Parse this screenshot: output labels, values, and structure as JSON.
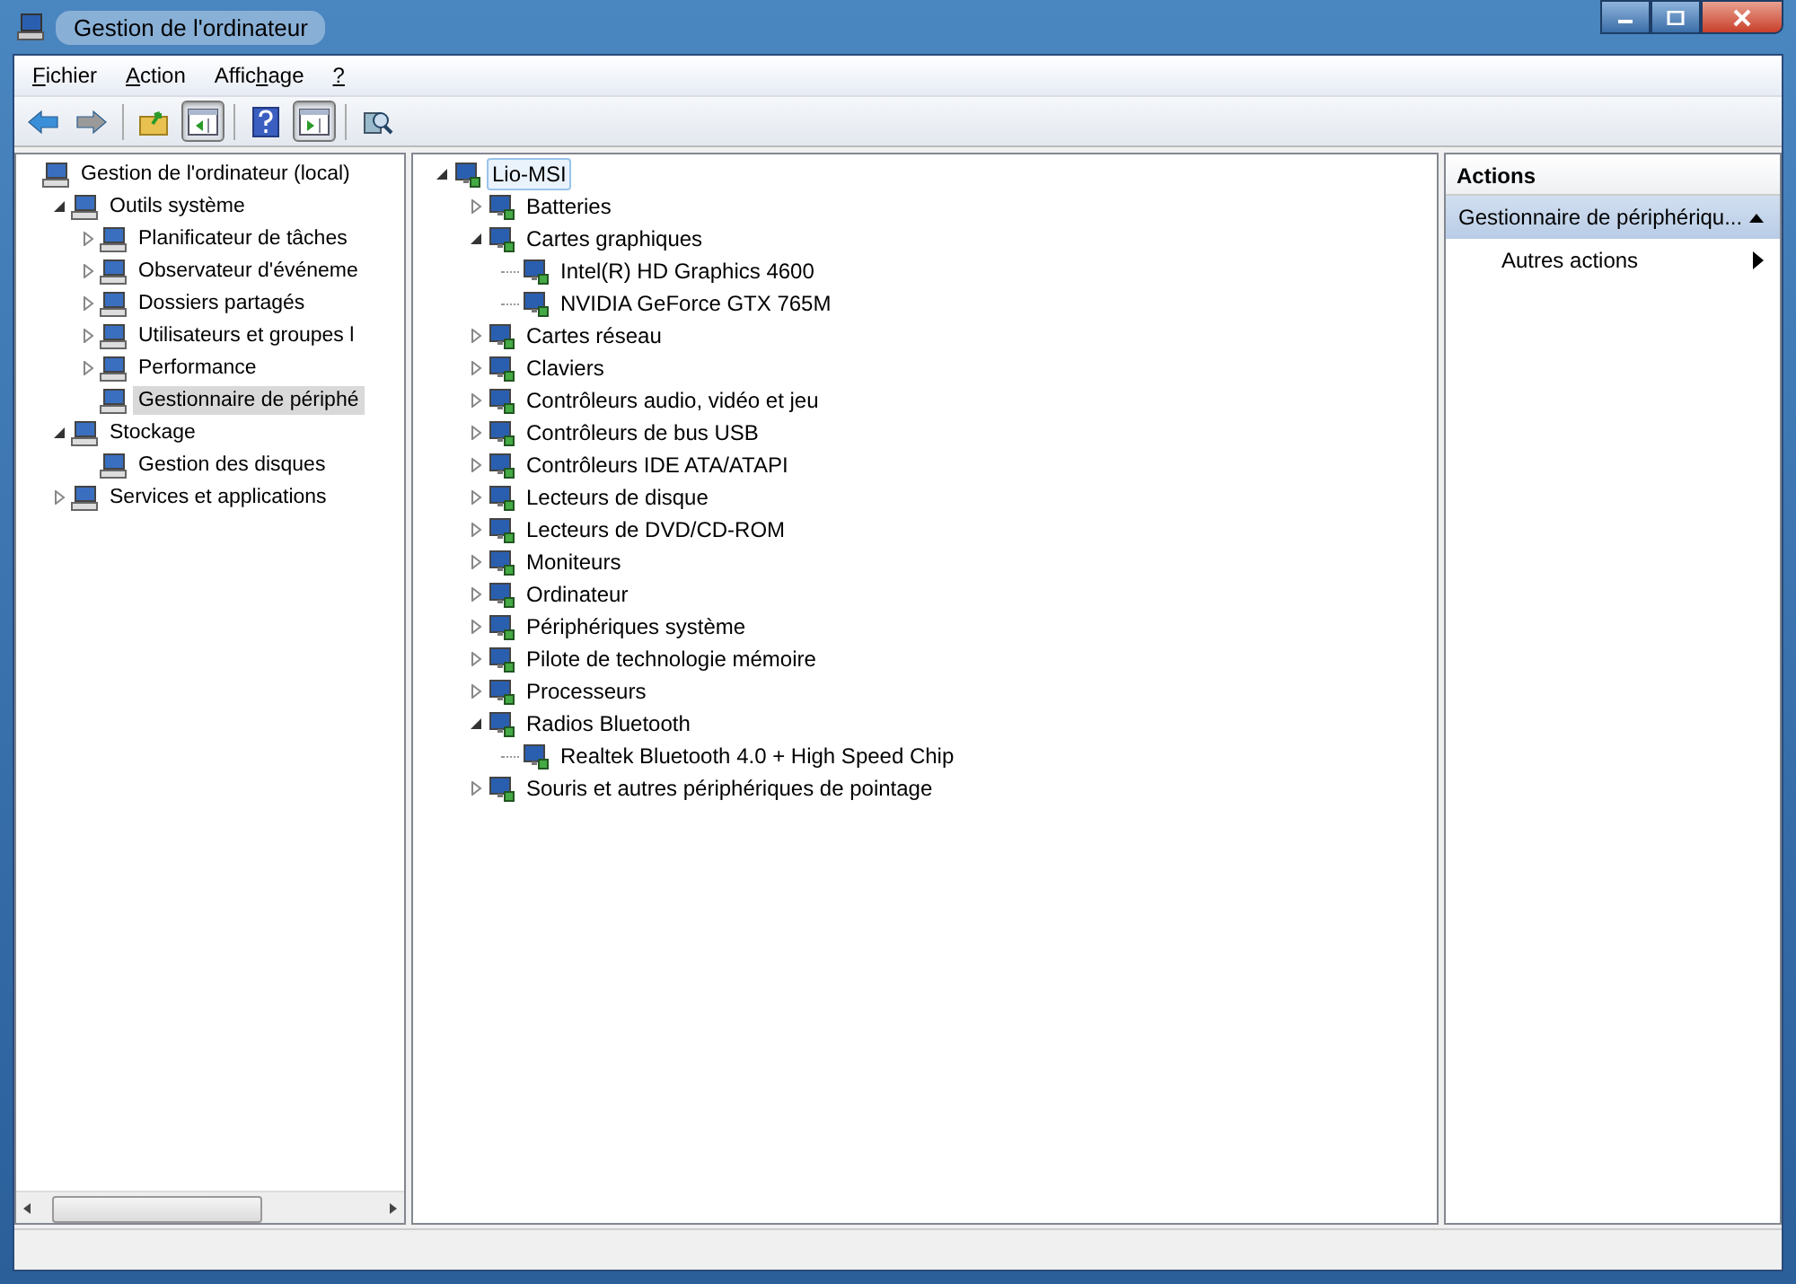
{
  "window": {
    "title": "Gestion de l'ordinateur"
  },
  "menu": [
    {
      "key": "F",
      "after": "ichier"
    },
    {
      "key": "A",
      "after": "ction"
    },
    {
      "before": "Affic",
      "key": "h",
      "after": "age"
    },
    {
      "key": "?"
    }
  ],
  "toolbar": [
    {
      "kind": "back",
      "disabled": false
    },
    {
      "kind": "forward",
      "disabled": true
    },
    {
      "kind": "separator"
    },
    {
      "kind": "up"
    },
    {
      "kind": "console-tree",
      "pressed": true
    },
    {
      "kind": "separator"
    },
    {
      "kind": "help"
    },
    {
      "kind": "action-pane",
      "pressed": true
    },
    {
      "kind": "separator"
    },
    {
      "kind": "properties"
    }
  ],
  "console_tree": [
    {
      "label": "Gestion de l'ordinateur (local)",
      "selected": false,
      "children": [
        {
          "label": "Outils système",
          "expanded": true,
          "selected": false,
          "children": [
            {
              "label": "Planificateur de tâches",
              "expanded": false,
              "selected": false
            },
            {
              "label": "Observateur d'événeme",
              "expanded": false,
              "selected": false
            },
            {
              "label": "Dossiers partagés",
              "expanded": false,
              "selected": false
            },
            {
              "label": "Utilisateurs et groupes l",
              "expanded": false,
              "selected": false
            },
            {
              "label": "Performance",
              "expanded": false,
              "selected": false
            },
            {
              "label": "Gestionnaire de périphé",
              "selected": true
            }
          ]
        },
        {
          "label": "Stockage",
          "expanded": true,
          "selected": false,
          "children": [
            {
              "label": "Gestion des disques",
              "selected": false
            }
          ]
        },
        {
          "label": "Services et applications",
          "expanded": false,
          "selected": false
        }
      ]
    }
  ],
  "device_tree": [
    {
      "label": "Lio-MSI",
      "expanded": true,
      "selected": true,
      "children": [
        {
          "label": "Batteries",
          "expanded": false,
          "selected": false
        },
        {
          "label": "Cartes graphiques",
          "expanded": true,
          "selected": false,
          "children": [
            {
              "label": "Intel(R) HD Graphics 4600",
              "selected": false
            },
            {
              "label": "NVIDIA GeForce GTX 765M",
              "selected": false
            }
          ]
        },
        {
          "label": "Cartes réseau",
          "expanded": false,
          "selected": false
        },
        {
          "label": "Claviers",
          "expanded": false,
          "selected": false
        },
        {
          "label": "Contrôleurs audio, vidéo et jeu",
          "expanded": false,
          "selected": false
        },
        {
          "label": "Contrôleurs de bus USB",
          "expanded": false,
          "selected": false
        },
        {
          "label": "Contrôleurs IDE ATA/ATAPI",
          "expanded": false,
          "selected": false
        },
        {
          "label": "Lecteurs de disque",
          "expanded": false,
          "selected": false
        },
        {
          "label": "Lecteurs de DVD/CD-ROM",
          "expanded": false,
          "selected": false
        },
        {
          "label": "Moniteurs",
          "expanded": false,
          "selected": false
        },
        {
          "label": "Ordinateur",
          "expanded": false,
          "selected": false
        },
        {
          "label": "Périphériques système",
          "expanded": false,
          "selected": false
        },
        {
          "label": "Pilote de technologie mémoire",
          "expanded": false,
          "selected": false
        },
        {
          "label": "Processeurs",
          "expanded": false,
          "selected": false
        },
        {
          "label": "Radios Bluetooth",
          "expanded": true,
          "selected": false,
          "children": [
            {
              "label": "Realtek Bluetooth 4.0 + High Speed Chip",
              "selected": false
            }
          ]
        },
        {
          "label": "Souris et autres périphériques de pointage",
          "expanded": false,
          "selected": false
        }
      ]
    }
  ],
  "actions": {
    "title": "Actions",
    "sections": [
      {
        "label": "Gestionnaire de périphériqu...",
        "expanded": true,
        "items": [
          {
            "label": "Autres actions",
            "submenu": true
          }
        ]
      }
    ]
  }
}
